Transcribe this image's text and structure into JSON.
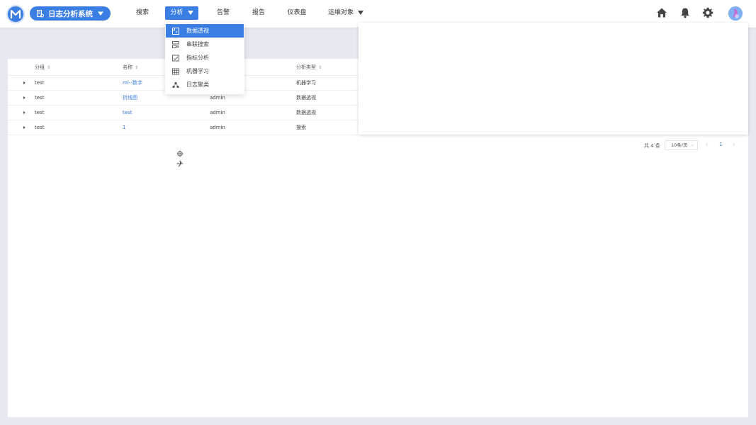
{
  "app": {
    "name": "日志分析系统"
  },
  "nav": {
    "items": [
      {
        "label": "搜索"
      },
      {
        "label": "分析"
      },
      {
        "label": "告警"
      },
      {
        "label": "报告"
      },
      {
        "label": "仪表盘"
      },
      {
        "label": "运维对象"
      }
    ]
  },
  "dropdown": {
    "items": [
      {
        "label": "数据透视",
        "icon": "pivot-icon"
      },
      {
        "label": "串联搜索",
        "icon": "chain-search-icon"
      },
      {
        "label": "指标分析",
        "icon": "metric-icon"
      },
      {
        "label": "机器学习",
        "icon": "ml-icon"
      },
      {
        "label": "日志聚类",
        "icon": "cluster-icon"
      }
    ]
  },
  "table": {
    "columns": [
      "分组",
      "名称",
      "",
      "分析类型"
    ],
    "rows": [
      {
        "group": "test",
        "name": "ml--数字",
        "owner": "",
        "type": "机器学习"
      },
      {
        "group": "test",
        "name": "折线图",
        "owner": "admin",
        "type": "数据透视"
      },
      {
        "group": "test",
        "name": "test",
        "owner": "admin",
        "type": "数据透视"
      },
      {
        "group": "test",
        "name": "1",
        "owner": "admin",
        "type": "搜索"
      }
    ]
  },
  "pagination": {
    "total": "共 4 条",
    "page_size": "10条/页",
    "current": "1",
    "prev": "‹",
    "next": "›"
  },
  "colors": {
    "accent": "#3a7ee3",
    "background": "#e6e9ef"
  }
}
